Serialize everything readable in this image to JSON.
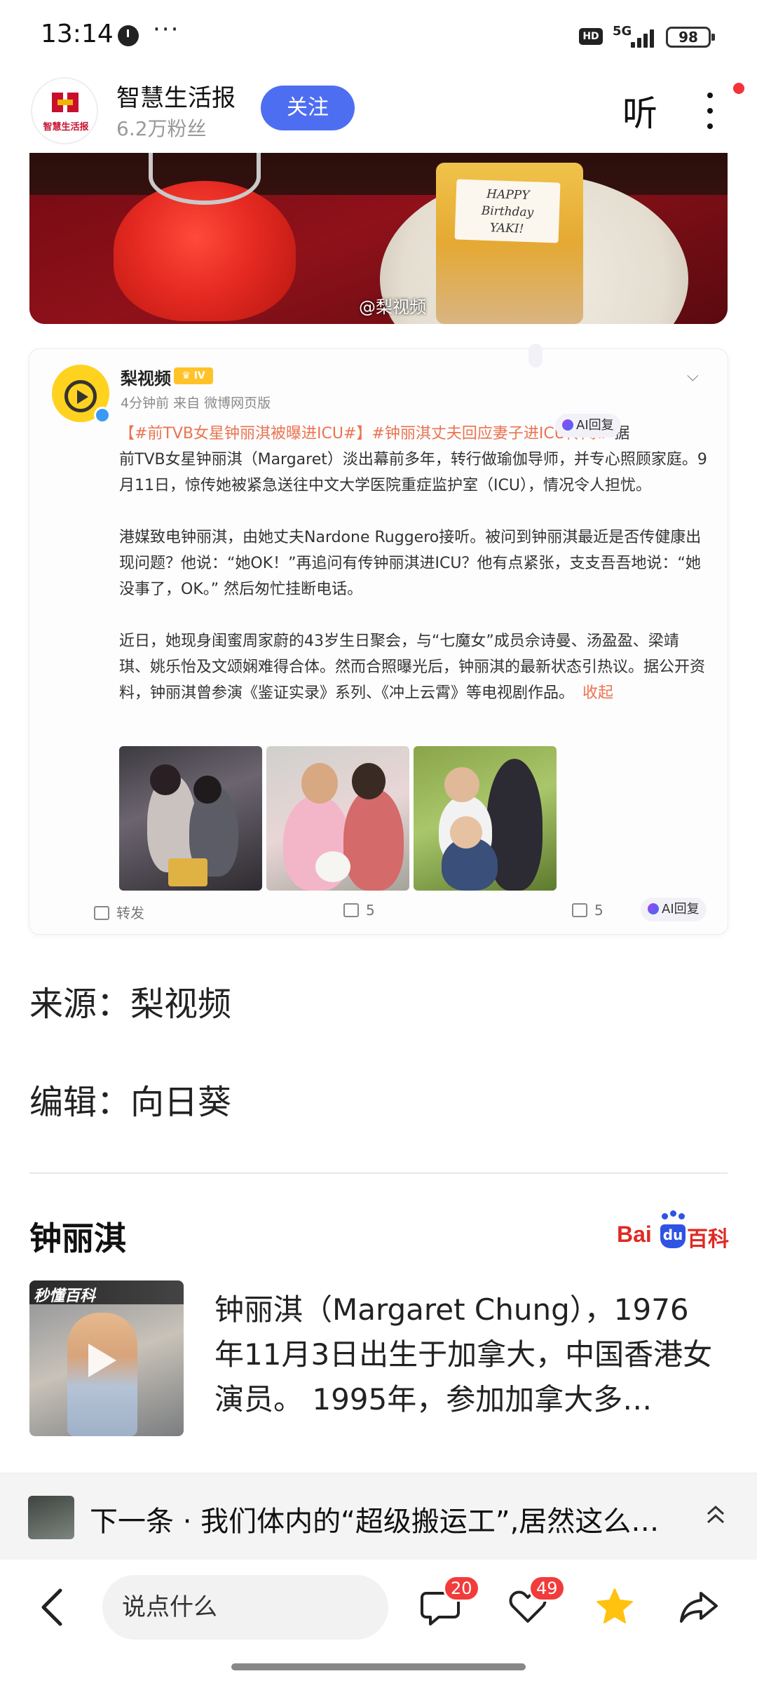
{
  "status_bar": {
    "time": "13:14",
    "dots": "···",
    "hd": "HD",
    "network": "5G",
    "battery": "98"
  },
  "header": {
    "source_name": "智慧生活报",
    "followers": "6.2万粉丝",
    "follow_label": "关注",
    "listen_label": "听",
    "avatar_text": "智慧生活报"
  },
  "top_photo": {
    "card_text_line1": "HAPPY",
    "card_text_line2": "Birthday",
    "card_text_line3": "YAKI!",
    "watermark": "@梨视频"
  },
  "weibo": {
    "author": "梨视频",
    "badge": "♛ IV",
    "time_source": "4分钟前  来自 微博网页版",
    "tag1": "【#前TVB女星钟丽淇被曝进ICU#】",
    "tag2": "#钟丽淇丈夫回应妻子进ICU传闻#",
    "para1_tail": " 据",
    "para1_body": "前TVB女星钟丽淇（Margaret）淡出幕前多年，转行做瑜伽导师，并专心照顾家庭。9月11日，惊传她被紧急送往中文大学医院重症监护室（ICU），情况令人担忧。",
    "para2": "港媒致电钟丽淇，由她丈夫Nardone Ruggero接听。被问到钟丽淇最近是否传健康出现问题？他说：“她OK！”再追问有传钟丽淇进ICU？他有点紧张，支支吾吾地说：“她没事了，OK。” 然后匆忙挂断电话。",
    "para3": "近日，她现身闺蜜周家蔚的43岁生日聚会，与“七魔女”成员佘诗曼、汤盈盈、梁靖琪、姚乐怡及文颂娴难得合体。然而合照曝光后，钟丽淇的最新状态引热议。据公开资料，钟丽淇曾参演《鉴证实录》系列、《冲上云霄》等电视剧作品。",
    "collapse": "收起",
    "ai_reply": "AI回复",
    "repost_label": "转发",
    "comment_count": "5",
    "like_count": "5"
  },
  "meta": {
    "source_line": "来源：梨视频",
    "editor_line": "编辑：向日葵"
  },
  "baike": {
    "title": "钟丽淇",
    "logo_bai": "Bai",
    "logo_du": "du",
    "logo_bk": "百科",
    "thumb_label": "秒懂百科",
    "description": "钟丽淇（Margaret Chung），1976年11月3日出生于加拿大，中国香港女演员。 1995年，参加加拿大多…"
  },
  "next": {
    "text": "下一条 · 我们体内的“超级搬运工”,居然这么…"
  },
  "bottom_bar": {
    "comment_placeholder": "说点什么",
    "comments_badge": "20",
    "likes_badge": "49"
  },
  "colors": {
    "follow_blue": "#4e6ef2",
    "badge_red": "#f23b3b",
    "tag_orange": "#eb7350",
    "star_yellow": "#ffc20e"
  }
}
